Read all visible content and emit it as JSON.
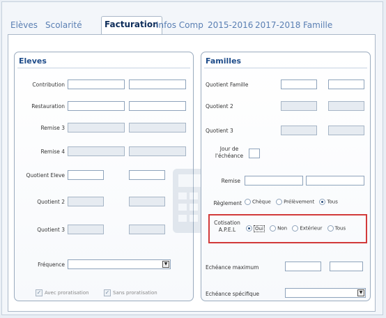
{
  "tabs": [
    "Elèves",
    "Scolarité",
    "Facturation",
    "Infos Comp",
    "2015-2016",
    "2017-2018",
    "Famille"
  ],
  "active_tab": "Facturation",
  "eleves": {
    "title": "Eleves",
    "rows": {
      "contribution": "Contribution",
      "restauration": "Restauration",
      "remise3": "Remise 3",
      "remise4": "Remise 4",
      "quotient_eleve": "Quotient Eleve",
      "quotient2": "Quotient 2",
      "quotient3": "Quotient 3",
      "frequence": "Fréquence"
    },
    "frequence_value": "",
    "check1": "Avec proratisation",
    "check2": "Sans proratisation"
  },
  "familles": {
    "title": "Familles",
    "quotient_famille": "Quotient Famille",
    "quotient2": "Quotient 2",
    "quotient3": "Quotient 3",
    "jour_echeance": "Jour de l'échéance",
    "remise": "Remise",
    "reglement_label": "Règlement",
    "reglement_options": [
      "Chèque",
      "Prélèvement",
      "Tous"
    ],
    "reglement_selected": "Tous",
    "cotisation_label": "Cotisation A.P.E.L",
    "cotisation_options": [
      "Oui",
      "Non",
      "Extérieur",
      "Tous"
    ],
    "cotisation_selected": "Oui",
    "echeance_max": "Echéance maximum",
    "echeance_spec": "Echéance spécifique",
    "echeance_spec_value": ""
  },
  "colors": {
    "highlight": "#d23a3a",
    "active_tab_text": "#0e2d5a",
    "tab_text": "#5a7fb3"
  },
  "icons": {
    "dropdown": "chevron-down-icon",
    "calculator": "calculator-icon",
    "check": "checkbox-icon"
  }
}
